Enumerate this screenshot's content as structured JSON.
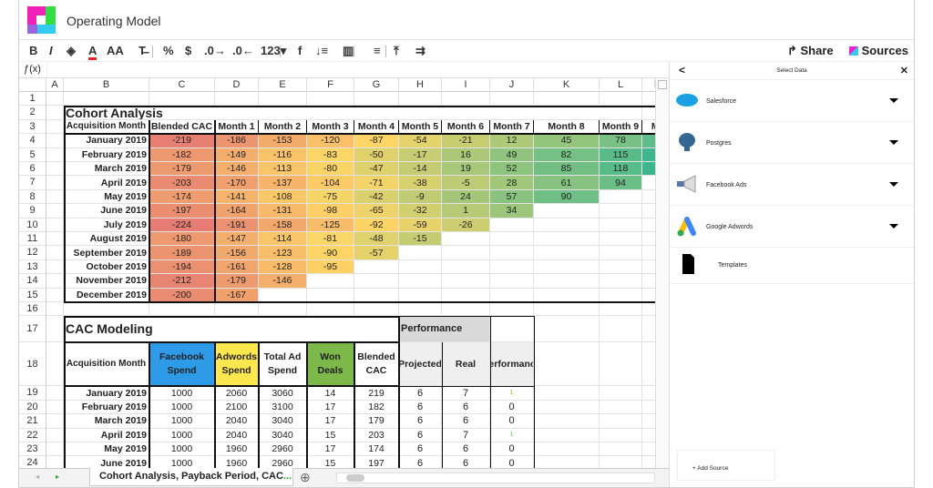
{
  "app": {
    "title": "Operating Model"
  },
  "toolbar": {
    "items": [
      "B",
      "I",
      "◈",
      "A",
      "AA",
      "T̶",
      "%",
      "$",
      ".0→",
      ".0←",
      "123▾",
      "f",
      "↓≡",
      "▥",
      "≡",
      "⤒",
      "⇉"
    ],
    "share": "Share",
    "sources": "Sources"
  },
  "formula_bar": {
    "label": "ƒ(x)",
    "value": ""
  },
  "columns": [
    "A",
    "B",
    "C",
    "D",
    "E",
    "F",
    "G",
    "H",
    "I",
    "J",
    "K",
    "L",
    "M"
  ],
  "rows": [
    "1",
    "2",
    "3",
    "4",
    "5",
    "6",
    "7",
    "8",
    "9",
    "10",
    "11",
    "12",
    "13",
    "14",
    "15",
    "16",
    "17",
    "18",
    "19",
    "20",
    "21",
    "22",
    "23",
    "24"
  ],
  "cohort": {
    "title": "Cohort Analysis",
    "headers": [
      "Acquisition Month",
      "Blended CAC",
      "Month 1",
      "Month 2",
      "Month 3",
      "Month 4",
      "Month 5",
      "Month 6",
      "Month 7",
      "Month 8",
      "Month 9",
      "Mo"
    ],
    "months": [
      "January 2019",
      "February 2019",
      "March 2019",
      "April 2019",
      "May 2019",
      "June 2019",
      "July 2019",
      "August 2019",
      "September 2019",
      "October 2019",
      "November 2019",
      "December 2019"
    ],
    "values": [
      [
        -219,
        -186,
        -153,
        -120,
        -87,
        -54,
        -21,
        12,
        45,
        78
      ],
      [
        -182,
        -149,
        -116,
        -83,
        -50,
        -17,
        16,
        49,
        82,
        115
      ],
      [
        -179,
        -146,
        -113,
        -80,
        -47,
        -14,
        19,
        52,
        85,
        118
      ],
      [
        -203,
        -170,
        -137,
        -104,
        -71,
        -38,
        -5,
        28,
        61,
        94
      ],
      [
        -174,
        -141,
        -108,
        -75,
        -42,
        -9,
        24,
        57,
        90
      ],
      [
        -197,
        -164,
        -131,
        -98,
        -65,
        -32,
        1,
        34
      ],
      [
        -224,
        -191,
        -158,
        -125,
        -92,
        -59,
        -26
      ],
      [
        -180,
        -147,
        -114,
        -81,
        -48,
        -15
      ],
      [
        -189,
        -156,
        -123,
        -90,
        -57
      ],
      [
        -194,
        -161,
        -128,
        -95
      ],
      [
        -212,
        -179,
        -146
      ],
      [
        -200,
        -167
      ]
    ],
    "scale_colors": {
      "min": "#e67c73",
      "mid": "#ffd666",
      "max": "#57bb8a"
    }
  },
  "cac": {
    "title": "CAC Modeling",
    "headers": [
      "Acquisition Month",
      "Facebook Spend",
      "Adwords Spend",
      "Total Ad Spend",
      "Won Deals",
      "Blended CAC"
    ],
    "header_colors": [
      "#ffffff",
      "#2d9be8",
      "#ffe84d",
      "#ffffff",
      "#7cb84a",
      "#ffffff"
    ],
    "rows": [
      [
        "January 2019",
        "1000",
        "2060",
        "3060",
        "14",
        "219"
      ],
      [
        "February 2019",
        "1000",
        "2100",
        "3100",
        "17",
        "182"
      ],
      [
        "March 2019",
        "1000",
        "2040",
        "3040",
        "17",
        "179"
      ],
      [
        "April 2019",
        "1000",
        "2040",
        "3040",
        "15",
        "203"
      ],
      [
        "May 2019",
        "1000",
        "1960",
        "2960",
        "17",
        "174"
      ],
      [
        "June 2019",
        "1000",
        "1960",
        "2960",
        "15",
        "197"
      ]
    ]
  },
  "performance": {
    "title": "Performance",
    "headers": [
      "Projected",
      "Real",
      "Performance"
    ],
    "rows": [
      [
        "6",
        "7",
        "1"
      ],
      [
        "6",
        "6",
        "0"
      ],
      [
        "6",
        "6",
        "0"
      ],
      [
        "6",
        "7",
        "1"
      ],
      [
        "6",
        "6",
        "0"
      ],
      [
        "6",
        "6",
        "0"
      ]
    ]
  },
  "tabs": {
    "active": "Cohort Analysis, Payback Period, CAC",
    "more": "...",
    "add": "⊕"
  },
  "panel": {
    "back": "<",
    "title": "Select Data",
    "close": "✕",
    "sources": [
      {
        "name": "Salesforce",
        "icon": "salesforce-icon"
      },
      {
        "name": "Postgres",
        "icon": "postgres-icon"
      },
      {
        "name": "Facebook Ads",
        "icon": "megaphone-icon"
      },
      {
        "name": "Google Adwords",
        "icon": "google-ads-icon"
      }
    ],
    "templates": "Templates",
    "add_source": "+ Add Source"
  }
}
